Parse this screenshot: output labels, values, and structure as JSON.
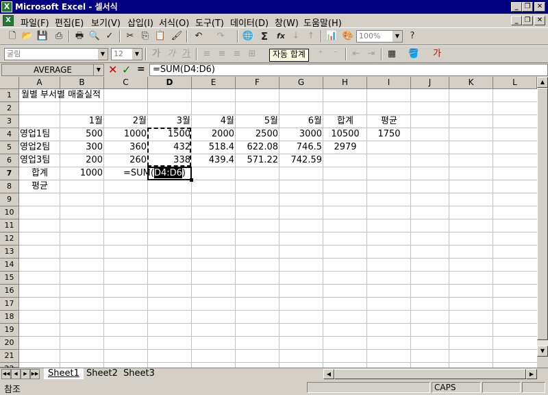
{
  "window": {
    "title": "Microsoft Excel - 셀서식",
    "app_icon": "excel-icon",
    "min_label": "_",
    "restore_label": "❐",
    "close_label": "✕"
  },
  "menu": {
    "items": [
      "파일(F)",
      "편집(E)",
      "보기(V)",
      "삽입(I)",
      "서식(O)",
      "도구(T)",
      "데이터(D)",
      "창(W)",
      "도움말(H)"
    ]
  },
  "toolbar": {
    "zoom": "100%",
    "font_name": "굴림",
    "font_size": "12",
    "tooltip": "자동 합계",
    "autosum_symbol": "Σ",
    "function_symbol": "fx"
  },
  "formula_bar": {
    "name_box": "AVERAGE",
    "cancel_symbol": "✕",
    "enter_symbol": "✓",
    "equals_symbol": "=",
    "formula": "=SUM(D4:D6)"
  },
  "sheet": {
    "columns": [
      "A",
      "B",
      "C",
      "D",
      "E",
      "F",
      "G",
      "H",
      "I",
      "J",
      "K",
      "L"
    ],
    "active_column": "D",
    "active_row": "7",
    "rows": [
      "1",
      "2",
      "3",
      "4",
      "5",
      "6",
      "7",
      "8",
      "9",
      "10",
      "11",
      "12",
      "13",
      "14",
      "15",
      "16",
      "17",
      "18",
      "19",
      "20",
      "21",
      "22"
    ],
    "cells": {
      "A1": "월별 부서별 매출실적",
      "B3": "1월",
      "C3": "2월",
      "D3": "3월",
      "E3": "4월",
      "F3": "5월",
      "G3": "6월",
      "H3": "합계",
      "I3": "평균",
      "A4": "영업1팀",
      "B4": "500",
      "C4": "1000",
      "D4": "1500",
      "E4": "2000",
      "F4": "2500",
      "G4": "3000",
      "H4": "10500",
      "I4": "1750",
      "A5": "영업2팀",
      "B5": "300",
      "C5": "360",
      "D5": "432",
      "E5": "518.4",
      "F5": "622.08",
      "G5": "746.5",
      "H5": "2979",
      "A6": "영업3팀",
      "B6": "200",
      "C6": "260",
      "D6": "338",
      "E6": "439.4",
      "F6": "571.22",
      "G6": "742.59",
      "A7": "합계",
      "B7": "1000",
      "A8": "평균",
      "D7_formula_prefix": "=SUM(",
      "D7_formula_ref": "D4:D6",
      "D7_formula_suffix": ")"
    }
  },
  "sheet_tabs": [
    "Sheet1",
    "Sheet2",
    "Sheet3"
  ],
  "status": {
    "mode": "참조",
    "caps": "CAPS"
  },
  "colors": {
    "title_bar": "#000080",
    "selection": "#000000",
    "cancel": "#cc0000",
    "enter": "#008000"
  }
}
